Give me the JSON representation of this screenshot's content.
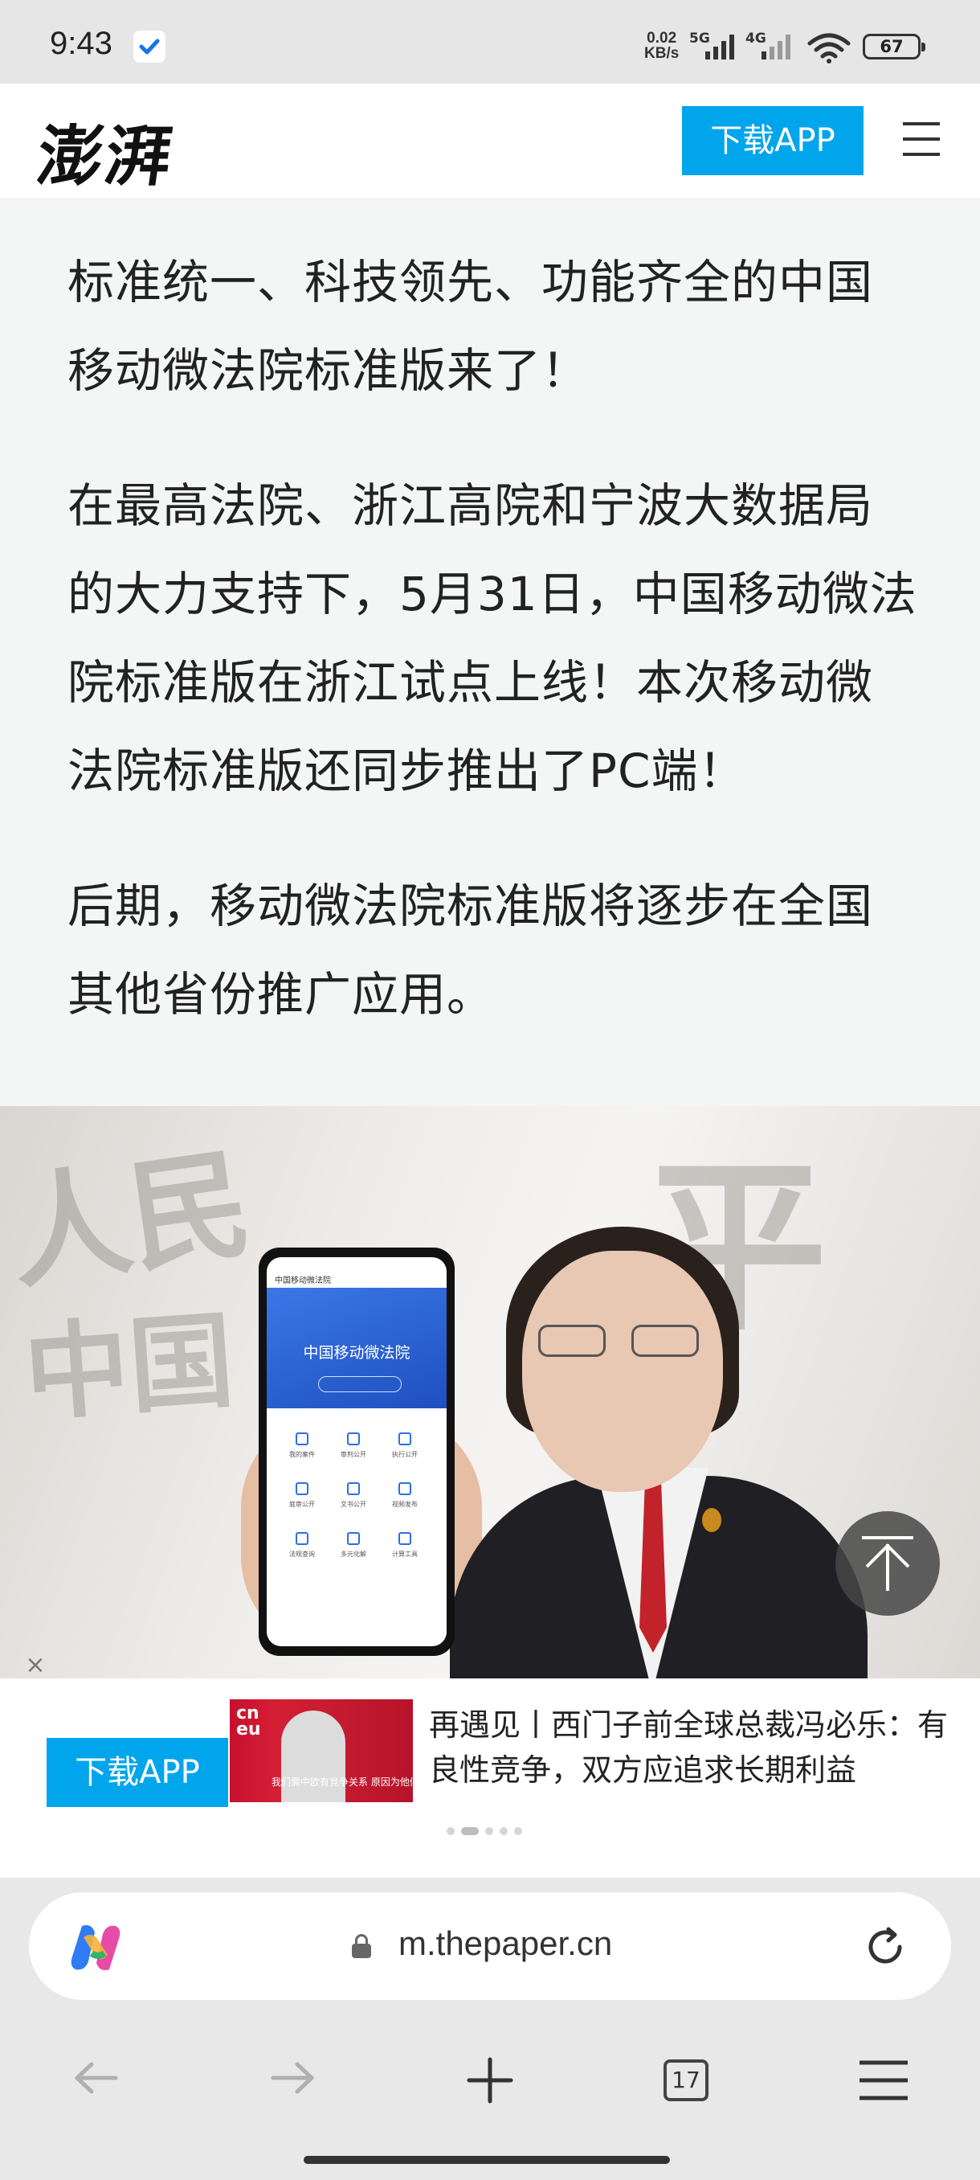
{
  "status_bar": {
    "time": "9:43",
    "speed_value": "0.02",
    "speed_unit": "KB/s",
    "network1": "5G",
    "network2": "4G",
    "battery": "67",
    "icons": [
      "check-badge-icon",
      "signal-icon",
      "wifi-icon",
      "battery-icon"
    ]
  },
  "header": {
    "logo": "澎湃",
    "download_label": "下载APP",
    "accent_color": "#00a5eb"
  },
  "article": {
    "paragraphs": [
      "标准统一、科技领先、功能齐全的中国移动微法院标准版来了！",
      "在最高法院、浙江高院和宁波大数据局的大力支持下，5月31日，中国移动微法院标准版在浙江试点上线！本次移动微法院标准版还同步推出了PC端！",
      "后期，移动微法院标准版将逐步在全国其他省份推广应用。"
    ]
  },
  "photo": {
    "phone_app_title": "中国移动微法院",
    "phone_banner_title": "中国移动微法院",
    "phone_grid": [
      "我的案件",
      "审判公开",
      "执行公开",
      "庭审公开",
      "文书公开",
      "视频发布",
      "法规查询",
      "多元化解",
      "计算工具"
    ]
  },
  "ad": {
    "download_label": "下载APP",
    "headline": "再遇见丨西门子前全球总裁冯必乐：有良性竞争，双方应追求长期利益",
    "thumb_brand": "cn eu",
    "thumb_caption": "我们需中欧有竞争关系 原因为他们很成功"
  },
  "browser": {
    "url": "m.thepaper.cn",
    "tab_count": "17"
  }
}
